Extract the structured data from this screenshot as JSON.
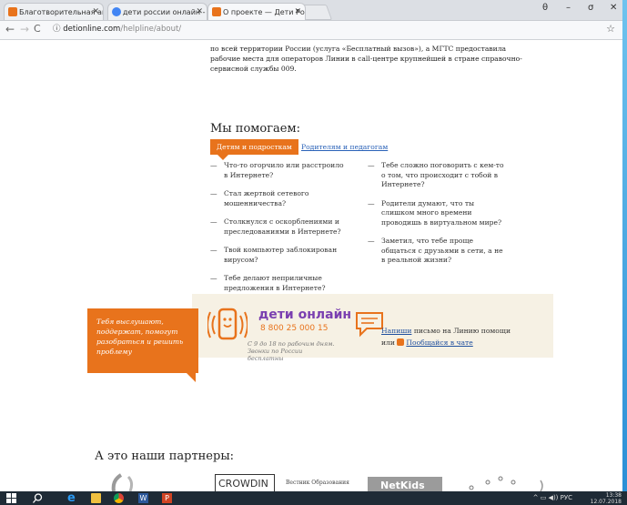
{
  "browser": {
    "tabs": [
      {
        "label": "Благотворительная акц",
        "color": "#e8731c"
      },
      {
        "label": "дети россии онлайн - П",
        "color": "#4285f4"
      },
      {
        "label": "О проекте — Дети Росс",
        "color": "#e8731c"
      }
    ],
    "window_controls": [
      "θ",
      "–",
      "σ",
      "✕"
    ],
    "url_host": "detionline.com",
    "url_path": "/helpline/about/",
    "info_icon": "ⓘ"
  },
  "page": {
    "intro": "по всей территории России (услуга «Бесплатный вызов»), а МГТС предоставила рабочие места для операторов Линии в call-центре крупнейшей в стране справочно-сервисной службы 009.",
    "help_title": "Мы помогаем:",
    "tab_kids": "Детям и подросткам",
    "tab_parents": "Родителям и педагогам",
    "questions_col1": [
      "Что-то огорчило или расстроило в Интернете?",
      "Стал жертвой сетевого мошенничества?",
      "Столкнулся с оскорблениями и преследованиями в Интернете?",
      "Твой компьютер заблокирован вирусом?",
      "Тебе делают неприличные предложения в Интернете?"
    ],
    "questions_col2": [
      "Тебе сложно поговорить с кем-то о том, что происходит с тобой в Интернете?",
      "Родители думают, что ты слишком много времени проводишь в виртуальном мире?",
      "Заметил, что тебе проще общаться с друзьями в сети, а не в реальной жизни?"
    ],
    "banner": {
      "slogan": "Тебя выслушают, поддержат, помогут разобраться и решить проблему",
      "brand": "дети онлайн",
      "phone": "8 800 25 000 15",
      "hours": "С 9 до 18 по рабочим дням. Звонки по России бесплатны",
      "write_link": "Напиши",
      "write_text": " письмо на Линию помощи",
      "or_text": "или ",
      "chat_link": "Пообщайся в чате"
    },
    "partners_title": "А это наши партнеры:",
    "partners": [
      "CROWDIN",
      "Вестник Образования",
      "NetKids"
    ]
  },
  "taskbar": {
    "lang": "РУС",
    "time": "13:38",
    "date": "12.07.2018"
  }
}
